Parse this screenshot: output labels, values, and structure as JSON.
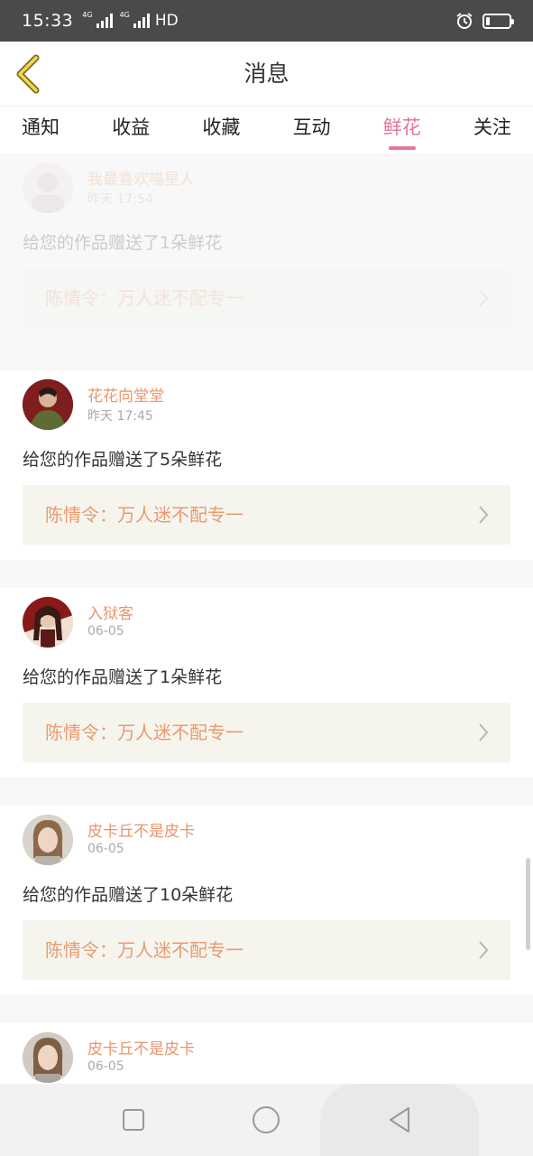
{
  "status_bar": {
    "time": "15:33",
    "network1": "4G",
    "network2": "4G",
    "hd": "HD"
  },
  "header": {
    "title": "消息",
    "back_icon": "chevron-left-icon"
  },
  "tabs": [
    {
      "label": "通知",
      "active": false
    },
    {
      "label": "收益",
      "active": false
    },
    {
      "label": "收藏",
      "active": false
    },
    {
      "label": "互动",
      "active": false
    },
    {
      "label": "鲜花",
      "active": true
    },
    {
      "label": "关注",
      "active": false
    }
  ],
  "colors": {
    "accent": "#e5759f",
    "username": "#e8966b",
    "work_title": "#ea9a70",
    "work_bg": "#f5f5ee"
  },
  "items": [
    {
      "username": "我最喜欢喵星人",
      "time": "昨天 17:54",
      "message": "给您的作品赠送了1朵鲜花",
      "work": "陈情令：万人迷不配专一"
    },
    {
      "username": "花花向堂堂",
      "time": "昨天 17:45",
      "message": "给您的作品赠送了5朵鲜花",
      "work": "陈情令：万人迷不配专一"
    },
    {
      "username": "入狱客",
      "time": "06-05",
      "message": "给您的作品赠送了1朵鲜花",
      "work": "陈情令：万人迷不配专一"
    },
    {
      "username": "皮卡丘不是皮卡",
      "time": "06-05",
      "message": "给您的作品赠送了10朵鲜花",
      "work": "陈情令：万人迷不配专一"
    },
    {
      "username": "皮卡丘不是皮卡",
      "time": "06-05"
    }
  ],
  "navbar": {
    "recents_icon": "square-icon",
    "home_icon": "circle-icon",
    "back_icon": "triangle-back-icon"
  }
}
